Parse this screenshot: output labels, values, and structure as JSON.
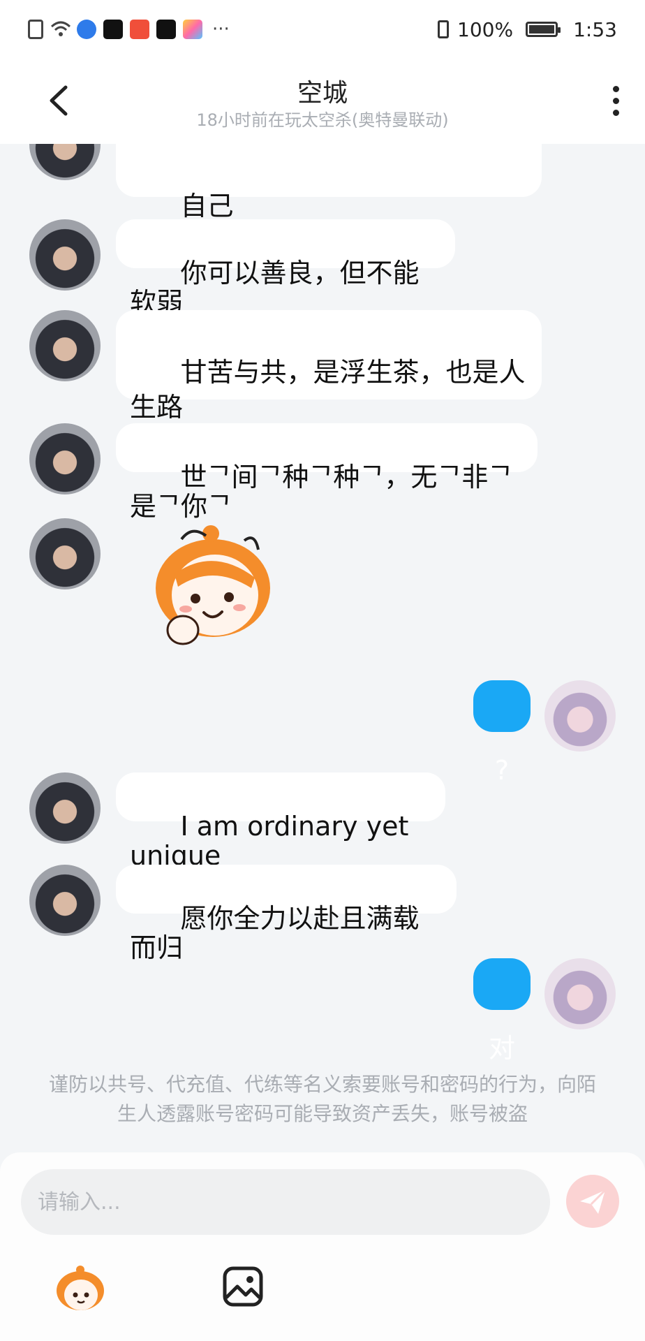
{
  "status_bar": {
    "battery": "100%",
    "time": "1:53",
    "more": "···",
    "battery_level": 1.0
  },
  "header": {
    "title": "空城",
    "subtitle": "18小时前在玩太空杀(奥特曼联动)"
  },
  "messages": [
    {
      "from": "other",
      "type": "text",
      "text": "自己"
    },
    {
      "from": "other",
      "type": "text",
      "text": "你可以善良，但不能软弱"
    },
    {
      "from": "other",
      "type": "text",
      "text": "甘苦与共，是浮生茶，也是人生路"
    },
    {
      "from": "other",
      "type": "text",
      "text": "世ᄀ间ᄀ种ᄀ种ᄀ，无ᄀ非ᄀ是ᄀ你ᄀ"
    },
    {
      "from": "other",
      "type": "sticker",
      "sticker": "orange-hair-character-thinking"
    },
    {
      "from": "me",
      "type": "text",
      "text": "?"
    },
    {
      "from": "other",
      "type": "text",
      "text": "I am ordinary yet unique"
    },
    {
      "from": "other",
      "type": "text",
      "text": "愿你全力以赴且满载而归"
    },
    {
      "from": "me",
      "type": "text",
      "text": "对"
    }
  ],
  "notice": "谨防以共号、代充值、代练等名义索要账号和密码的行为，向陌生人透露账号密码可能导致资产丢失，账号被盗",
  "input": {
    "placeholder": "请输入...",
    "value": ""
  },
  "colors": {
    "accent": "#1aa8f5",
    "send_button_disabled": "#fbd3d3",
    "background": "#f3f5f7"
  },
  "icons": [
    "back-arrow-icon",
    "more-vertical-icon",
    "send-icon",
    "emoji-sticker-icon",
    "image-icon"
  ]
}
